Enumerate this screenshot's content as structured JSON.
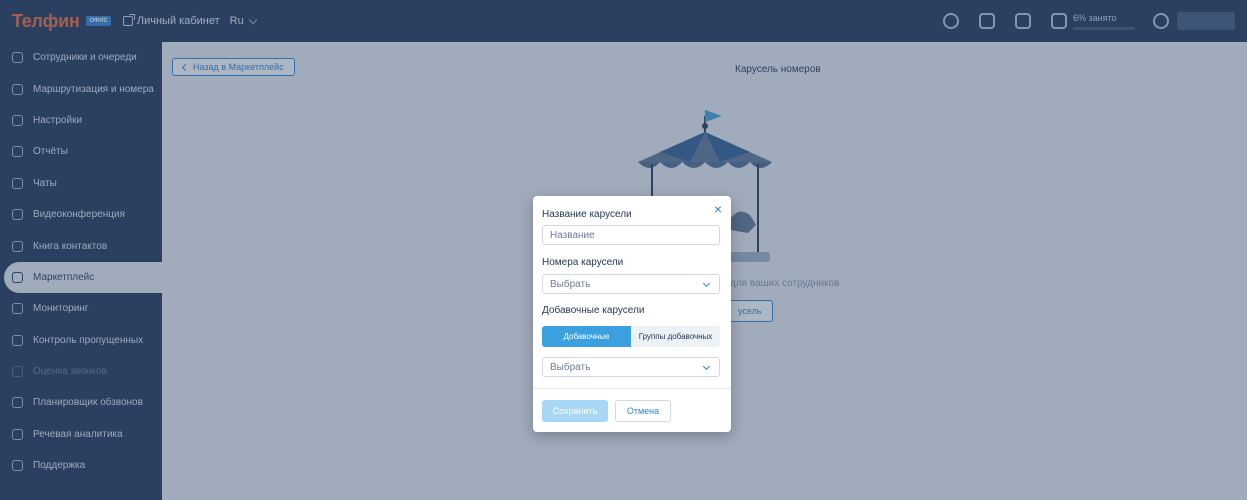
{
  "topbar": {
    "logo_text": "Телфин",
    "logo_badge": "ОФИС",
    "cabinet_label": "Личный кабинет",
    "lang": "Ru",
    "usage_text": "6% занято"
  },
  "sidebar": {
    "items": [
      {
        "label": "Сотрудники и очереди",
        "icon": "users-icon",
        "state": "normal"
      },
      {
        "label": "Маршрутизация и номера",
        "icon": "routing-icon",
        "state": "normal"
      },
      {
        "label": "Настройки",
        "icon": "settings-icon",
        "state": "normal"
      },
      {
        "label": "Отчёты",
        "icon": "reports-icon",
        "state": "normal"
      },
      {
        "label": "Чаты",
        "icon": "chat-icon",
        "state": "normal"
      },
      {
        "label": "Видеоконференция",
        "icon": "video-icon",
        "state": "normal"
      },
      {
        "label": "Книга контактов",
        "icon": "contacts-icon",
        "state": "normal"
      },
      {
        "label": "Маркетплейс",
        "icon": "marketplace-icon",
        "state": "active"
      },
      {
        "label": "Мониторинг",
        "icon": "monitoring-icon",
        "state": "normal"
      },
      {
        "label": "Контроль пропущенных",
        "icon": "missed-calls-icon",
        "state": "normal"
      },
      {
        "label": "Оценка звонков",
        "icon": "rating-icon",
        "state": "disabled"
      },
      {
        "label": "Планировщик обзвонов",
        "icon": "scheduler-icon",
        "state": "normal"
      },
      {
        "label": "Речевая аналитика",
        "icon": "speech-icon",
        "state": "normal"
      },
      {
        "label": "Поддержка",
        "icon": "support-icon",
        "state": "normal"
      }
    ]
  },
  "main": {
    "back_label": "Назад в Маркетплейс",
    "title": "Карусель номеров",
    "empty_text": "для ваших сотрудников",
    "create_label": "усель"
  },
  "modal": {
    "name_label": "Название карусели",
    "name_placeholder": "Название",
    "numbers_label": "Номера карусели",
    "numbers_select": "Выбрать",
    "extensions_label": "Добавочные карусели",
    "tab_extensions": "Добавочные",
    "tab_groups": "Группы добавочных",
    "extensions_select": "Выбрать",
    "save_label": "Сохранить",
    "cancel_label": "Отмена"
  },
  "colors": {
    "topbar_bg": "#1f3556",
    "accent": "#2b86d6",
    "logo": "#ef6a3a",
    "active_tab": "#3aa0e0"
  }
}
